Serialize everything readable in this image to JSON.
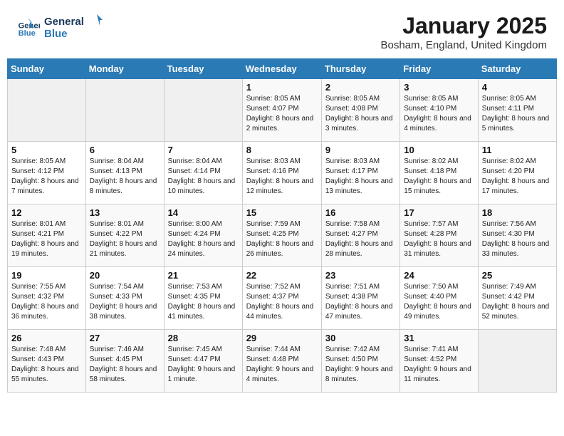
{
  "header": {
    "logo_line1": "General",
    "logo_line2": "Blue",
    "month": "January 2025",
    "location": "Bosham, England, United Kingdom"
  },
  "days_of_week": [
    "Sunday",
    "Monday",
    "Tuesday",
    "Wednesday",
    "Thursday",
    "Friday",
    "Saturday"
  ],
  "weeks": [
    [
      {
        "day": "",
        "info": ""
      },
      {
        "day": "",
        "info": ""
      },
      {
        "day": "",
        "info": ""
      },
      {
        "day": "1",
        "info": "Sunrise: 8:05 AM\nSunset: 4:07 PM\nDaylight: 8 hours and 2 minutes."
      },
      {
        "day": "2",
        "info": "Sunrise: 8:05 AM\nSunset: 4:08 PM\nDaylight: 8 hours and 3 minutes."
      },
      {
        "day": "3",
        "info": "Sunrise: 8:05 AM\nSunset: 4:10 PM\nDaylight: 8 hours and 4 minutes."
      },
      {
        "day": "4",
        "info": "Sunrise: 8:05 AM\nSunset: 4:11 PM\nDaylight: 8 hours and 5 minutes."
      }
    ],
    [
      {
        "day": "5",
        "info": "Sunrise: 8:05 AM\nSunset: 4:12 PM\nDaylight: 8 hours and 7 minutes."
      },
      {
        "day": "6",
        "info": "Sunrise: 8:04 AM\nSunset: 4:13 PM\nDaylight: 8 hours and 8 minutes."
      },
      {
        "day": "7",
        "info": "Sunrise: 8:04 AM\nSunset: 4:14 PM\nDaylight: 8 hours and 10 minutes."
      },
      {
        "day": "8",
        "info": "Sunrise: 8:03 AM\nSunset: 4:16 PM\nDaylight: 8 hours and 12 minutes."
      },
      {
        "day": "9",
        "info": "Sunrise: 8:03 AM\nSunset: 4:17 PM\nDaylight: 8 hours and 13 minutes."
      },
      {
        "day": "10",
        "info": "Sunrise: 8:02 AM\nSunset: 4:18 PM\nDaylight: 8 hours and 15 minutes."
      },
      {
        "day": "11",
        "info": "Sunrise: 8:02 AM\nSunset: 4:20 PM\nDaylight: 8 hours and 17 minutes."
      }
    ],
    [
      {
        "day": "12",
        "info": "Sunrise: 8:01 AM\nSunset: 4:21 PM\nDaylight: 8 hours and 19 minutes."
      },
      {
        "day": "13",
        "info": "Sunrise: 8:01 AM\nSunset: 4:22 PM\nDaylight: 8 hours and 21 minutes."
      },
      {
        "day": "14",
        "info": "Sunrise: 8:00 AM\nSunset: 4:24 PM\nDaylight: 8 hours and 24 minutes."
      },
      {
        "day": "15",
        "info": "Sunrise: 7:59 AM\nSunset: 4:25 PM\nDaylight: 8 hours and 26 minutes."
      },
      {
        "day": "16",
        "info": "Sunrise: 7:58 AM\nSunset: 4:27 PM\nDaylight: 8 hours and 28 minutes."
      },
      {
        "day": "17",
        "info": "Sunrise: 7:57 AM\nSunset: 4:28 PM\nDaylight: 8 hours and 31 minutes."
      },
      {
        "day": "18",
        "info": "Sunrise: 7:56 AM\nSunset: 4:30 PM\nDaylight: 8 hours and 33 minutes."
      }
    ],
    [
      {
        "day": "19",
        "info": "Sunrise: 7:55 AM\nSunset: 4:32 PM\nDaylight: 8 hours and 36 minutes."
      },
      {
        "day": "20",
        "info": "Sunrise: 7:54 AM\nSunset: 4:33 PM\nDaylight: 8 hours and 38 minutes."
      },
      {
        "day": "21",
        "info": "Sunrise: 7:53 AM\nSunset: 4:35 PM\nDaylight: 8 hours and 41 minutes."
      },
      {
        "day": "22",
        "info": "Sunrise: 7:52 AM\nSunset: 4:37 PM\nDaylight: 8 hours and 44 minutes."
      },
      {
        "day": "23",
        "info": "Sunrise: 7:51 AM\nSunset: 4:38 PM\nDaylight: 8 hours and 47 minutes."
      },
      {
        "day": "24",
        "info": "Sunrise: 7:50 AM\nSunset: 4:40 PM\nDaylight: 8 hours and 49 minutes."
      },
      {
        "day": "25",
        "info": "Sunrise: 7:49 AM\nSunset: 4:42 PM\nDaylight: 8 hours and 52 minutes."
      }
    ],
    [
      {
        "day": "26",
        "info": "Sunrise: 7:48 AM\nSunset: 4:43 PM\nDaylight: 8 hours and 55 minutes."
      },
      {
        "day": "27",
        "info": "Sunrise: 7:46 AM\nSunset: 4:45 PM\nDaylight: 8 hours and 58 minutes."
      },
      {
        "day": "28",
        "info": "Sunrise: 7:45 AM\nSunset: 4:47 PM\nDaylight: 9 hours and 1 minute."
      },
      {
        "day": "29",
        "info": "Sunrise: 7:44 AM\nSunset: 4:48 PM\nDaylight: 9 hours and 4 minutes."
      },
      {
        "day": "30",
        "info": "Sunrise: 7:42 AM\nSunset: 4:50 PM\nDaylight: 9 hours and 8 minutes."
      },
      {
        "day": "31",
        "info": "Sunrise: 7:41 AM\nSunset: 4:52 PM\nDaylight: 9 hours and 11 minutes."
      },
      {
        "day": "",
        "info": ""
      }
    ]
  ]
}
